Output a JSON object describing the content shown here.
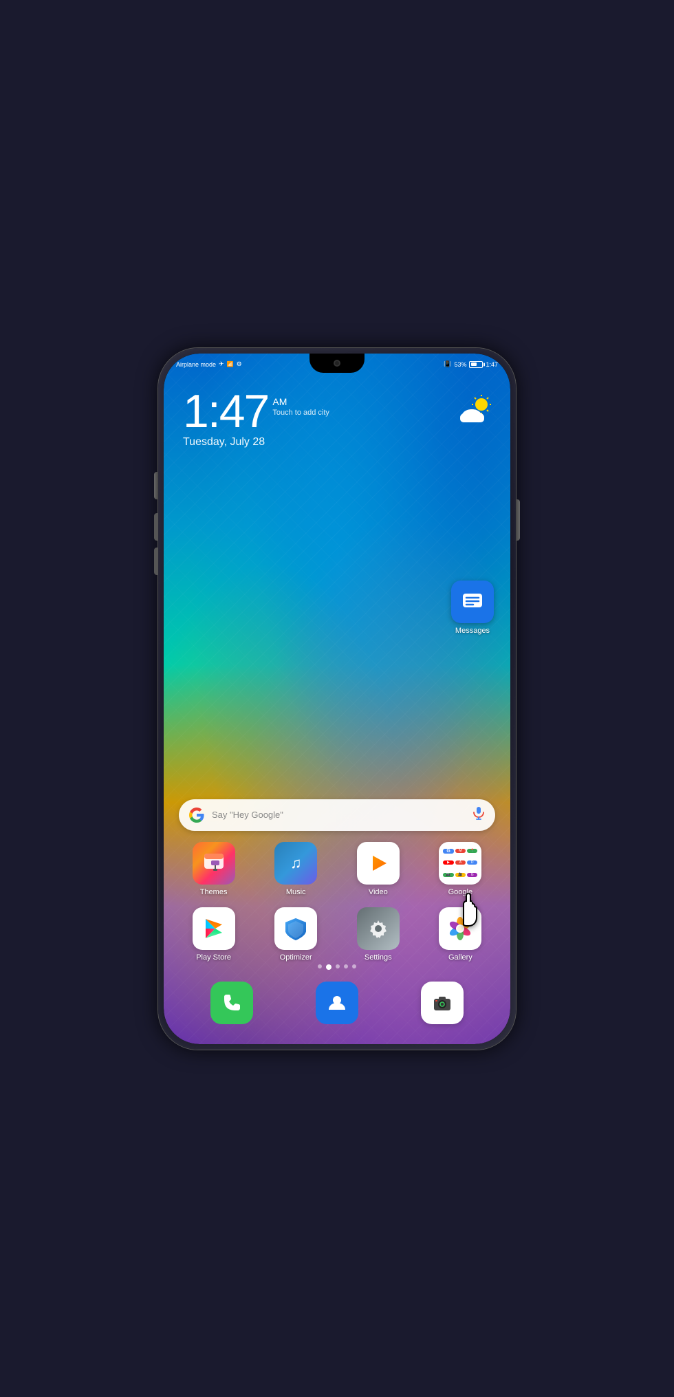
{
  "phone": {
    "status_bar": {
      "left": {
        "mode": "Airplane mode",
        "icons": [
          "airplane",
          "wifi-off",
          "settings"
        ]
      },
      "right": {
        "battery_percent": "53%",
        "time": "1:47"
      }
    },
    "clock_widget": {
      "time": "1:47",
      "ampm": "AM",
      "add_city": "Touch to add city",
      "date": "Tuesday, July 28"
    },
    "weather": {
      "icon": "partly-cloudy",
      "emoji": "⛅"
    },
    "search_bar": {
      "placeholder": "Say \"Hey Google\"",
      "google_letter": "G"
    },
    "messages_app": {
      "label": "Messages"
    },
    "app_grid": {
      "row1": [
        {
          "id": "themes",
          "label": "Themes",
          "icon_type": "themes"
        },
        {
          "id": "music",
          "label": "Music",
          "icon_type": "music"
        },
        {
          "id": "video",
          "label": "Video",
          "icon_type": "video"
        },
        {
          "id": "google",
          "label": "Google",
          "icon_type": "google-folder"
        }
      ],
      "row2": [
        {
          "id": "play-store",
          "label": "Play Store",
          "icon_type": "playstore"
        },
        {
          "id": "optimizer",
          "label": "Optimizer",
          "icon_type": "optimizer"
        },
        {
          "id": "settings",
          "label": "Settings",
          "icon_type": "settings"
        },
        {
          "id": "gallery",
          "label": "Gallery",
          "icon_type": "gallery"
        }
      ]
    },
    "dock": [
      {
        "id": "phone",
        "icon_type": "phone",
        "bg": "#34c759"
      },
      {
        "id": "contacts",
        "icon_type": "contacts",
        "bg": "#1a73e8"
      },
      {
        "id": "camera",
        "icon_type": "camera",
        "bg": "white"
      }
    ],
    "page_indicators": [
      {
        "active": false
      },
      {
        "active": true
      },
      {
        "active": false
      },
      {
        "active": false
      },
      {
        "active": false
      }
    ]
  }
}
